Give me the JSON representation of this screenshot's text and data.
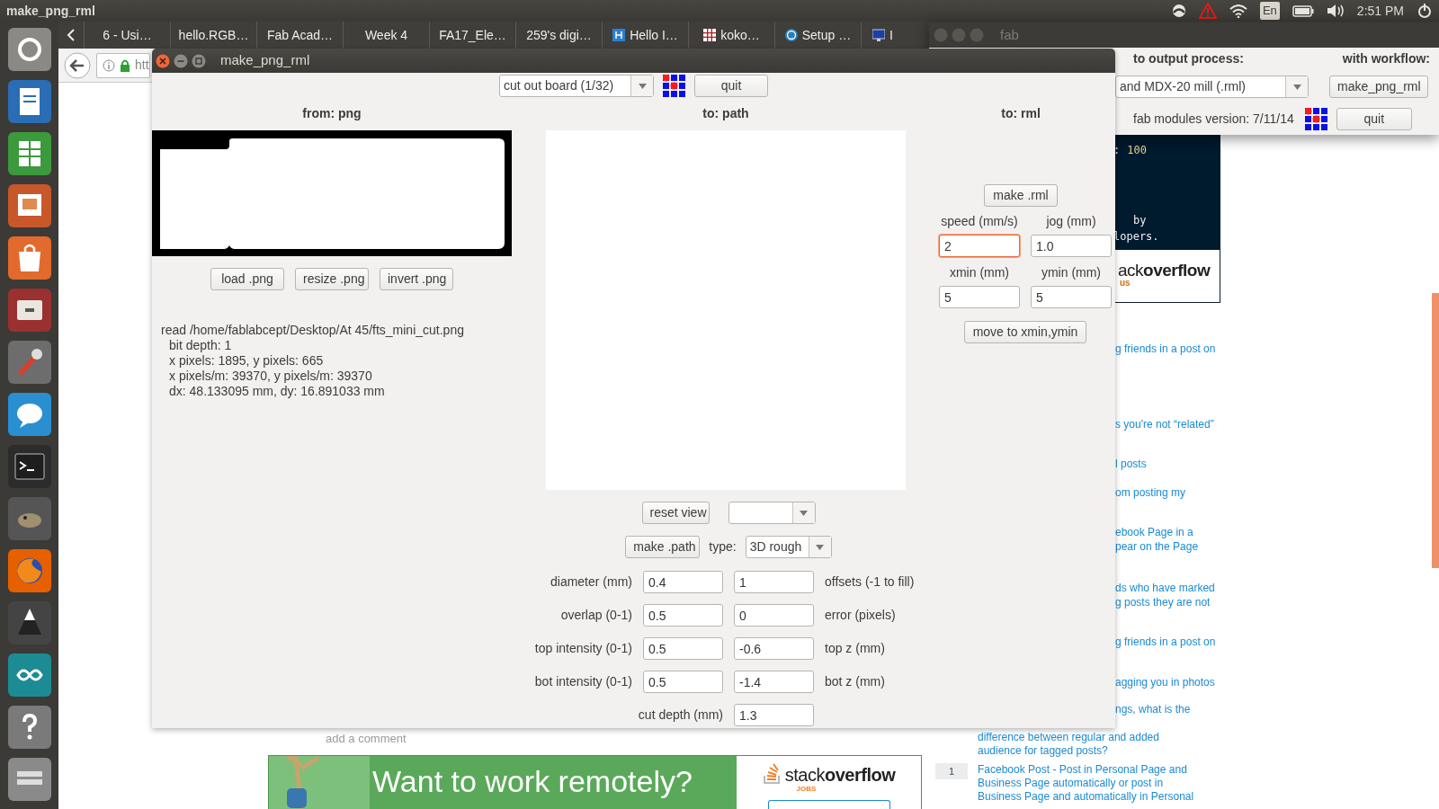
{
  "top_bar": {
    "title": "make_png_rml",
    "keyboard_layout": "En",
    "clock": "2:51 PM"
  },
  "browser": {
    "tabs": [
      {
        "label": "6 - Usi…",
        "selected": false
      },
      {
        "label": "hello.RGB…",
        "selected": false
      },
      {
        "label": "Fab Acad…",
        "selected": false
      },
      {
        "label": "Week 4",
        "selected": false
      },
      {
        "label": "FA17_Ele…",
        "selected": false
      },
      {
        "label": "259's digi…",
        "selected": false
      },
      {
        "label": "Hello I…",
        "selected": false
      },
      {
        "label": "koko…",
        "selected": false
      },
      {
        "label": "Setup …",
        "selected": false
      },
      {
        "label": "I",
        "selected": false
      }
    ],
    "address": "htt",
    "code_lines": [
      {
        "text": ":",
        "number": "100"
      },
      {
        "text": "by"
      },
      {
        "text": "lopers."
      }
    ],
    "ad_brand": "ack**overflow**",
    "ad_brand_sub": "us",
    "links": [
      {
        "lines": [
          "g friends in a post on"
        ]
      },
      {
        "lines": [
          "s you're not “related”"
        ]
      },
      {
        "lines": [
          "l posts"
        ]
      },
      {
        "lines": [
          "om posting my"
        ]
      },
      {
        "lines": [
          "ebook Page in a",
          "pear on the Page"
        ]
      },
      {
        "lines": [
          "ds who have marked",
          "g posts they are not"
        ]
      },
      {
        "lines": [
          "g friends in a post on"
        ]
      },
      {
        "lines": [
          "agging you in photos"
        ]
      },
      {
        "lines": [
          "ngs, what is the"
        ]
      }
    ],
    "bottom_links": [
      {
        "lines": [
          "difference between regular and added",
          "audience for tagged posts?"
        ]
      },
      {
        "votes": "1",
        "lines": [
          "Facebook Post - Post in Personal Page and",
          "Business Page automatically or post in",
          "Business Page and automatically in Personal"
        ]
      }
    ],
    "comment_link": "add a comment",
    "banner": {
      "headline": "Want to work remotely?",
      "brand": "stack**overflow**",
      "brand_sub": "JOBS"
    }
  },
  "fab_window": {
    "title": "fab",
    "process_heading": "to output process:",
    "workflow_heading": "with workflow:",
    "process": "and MDX-20 mill (.rml)",
    "workflow": "make_png_rml",
    "version": "fab modules version: 7/11/14",
    "quit": "quit"
  },
  "main_window": {
    "title": "make_png_rml",
    "mode": "cut out board (1/32)",
    "quit": "quit",
    "columns": [
      "from: png",
      "to: path",
      "to: rml"
    ],
    "png_buttons": [
      "load .png",
      "resize .png",
      "invert .png"
    ],
    "info": {
      "path_line": "read /home/fablabcept/Desktop/At 45/fts_mini_cut.png",
      "details": [
        "bit depth: 1",
        "x pixels: 1895, y pixels: 665",
        "x pixels/m: 39370, y pixels/m: 39370",
        "dx: 48.133095 mm, dy: 16.891033 mm"
      ]
    },
    "reset_view": "reset view",
    "make_path": "make .path",
    "type_label": "type:",
    "type": "3D rough",
    "params": [
      {
        "left_label": "diameter (mm)",
        "left_value": "0.4",
        "right_value": "1",
        "right_label": "offsets (-1 to fill)"
      },
      {
        "left_label": "overlap (0-1)",
        "left_value": "0.5",
        "right_value": "0",
        "right_label": "error (pixels)"
      },
      {
        "left_label": "top intensity (0-1)",
        "left_value": "0.5",
        "right_value": "-0.6",
        "right_label": "top z (mm)"
      },
      {
        "left_label": "bot intensity (0-1)",
        "left_value": "0.5",
        "right_value": "-1.4",
        "right_label": "bot z (mm)"
      }
    ],
    "cut_depth": {
      "label": "cut depth (mm)",
      "value": "1.3"
    },
    "make_rml": "make .rml",
    "rml_fields": [
      {
        "label": "speed (mm/s)",
        "value": "2",
        "focused": true
      },
      {
        "label": "jog (mm)",
        "value": "1.0",
        "focused": false
      },
      {
        "label": "xmin (mm)",
        "value": "5",
        "focused": false
      },
      {
        "label": "ymin (mm)",
        "value": "5",
        "focused": false
      }
    ],
    "move_button": "move to xmin,ymin"
  }
}
